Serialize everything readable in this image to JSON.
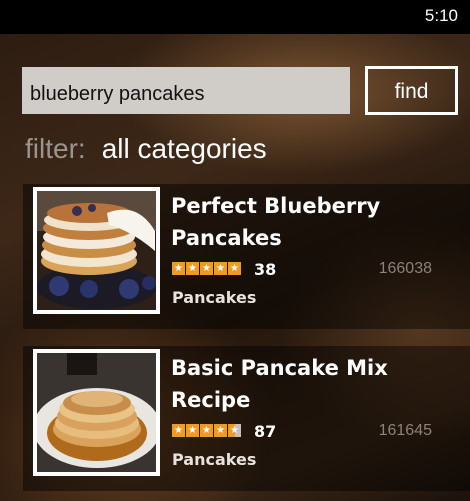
{
  "status": {
    "time": "5:10"
  },
  "search": {
    "value": "blueberry pancakes",
    "button_label": "find"
  },
  "filter": {
    "label": "filter:",
    "value": "all categories"
  },
  "results": [
    {
      "title_line1": "Perfect Blueberry",
      "title_line2": "Pancakes",
      "rating": 5,
      "reviews": "38",
      "id": "166038",
      "category": "Pancakes",
      "image": "blueberry-pancake-stack"
    },
    {
      "title_line1": "Basic Pancake Mix",
      "title_line2": "Recipe",
      "rating": 4.5,
      "reviews": "87",
      "id": "161645",
      "category": "Pancakes",
      "image": "pancake-stack-with-syrup"
    }
  ],
  "colors": {
    "accent": "#f09a23",
    "search_bg": "#d0ccc8"
  }
}
